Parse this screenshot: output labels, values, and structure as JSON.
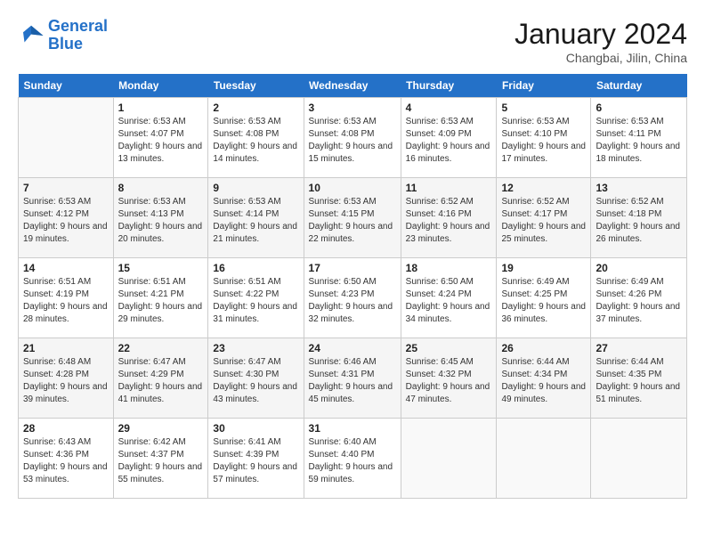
{
  "header": {
    "logo_line1": "General",
    "logo_line2": "Blue",
    "month_year": "January 2024",
    "location": "Changbai, Jilin, China"
  },
  "days_of_week": [
    "Sunday",
    "Monday",
    "Tuesday",
    "Wednesday",
    "Thursday",
    "Friday",
    "Saturday"
  ],
  "weeks": [
    [
      {
        "day": "",
        "sunrise": "",
        "sunset": "",
        "daylight": ""
      },
      {
        "day": "1",
        "sunrise": "Sunrise: 6:53 AM",
        "sunset": "Sunset: 4:07 PM",
        "daylight": "Daylight: 9 hours and 13 minutes."
      },
      {
        "day": "2",
        "sunrise": "Sunrise: 6:53 AM",
        "sunset": "Sunset: 4:08 PM",
        "daylight": "Daylight: 9 hours and 14 minutes."
      },
      {
        "day": "3",
        "sunrise": "Sunrise: 6:53 AM",
        "sunset": "Sunset: 4:08 PM",
        "daylight": "Daylight: 9 hours and 15 minutes."
      },
      {
        "day": "4",
        "sunrise": "Sunrise: 6:53 AM",
        "sunset": "Sunset: 4:09 PM",
        "daylight": "Daylight: 9 hours and 16 minutes."
      },
      {
        "day": "5",
        "sunrise": "Sunrise: 6:53 AM",
        "sunset": "Sunset: 4:10 PM",
        "daylight": "Daylight: 9 hours and 17 minutes."
      },
      {
        "day": "6",
        "sunrise": "Sunrise: 6:53 AM",
        "sunset": "Sunset: 4:11 PM",
        "daylight": "Daylight: 9 hours and 18 minutes."
      }
    ],
    [
      {
        "day": "7",
        "sunrise": "Sunrise: 6:53 AM",
        "sunset": "Sunset: 4:12 PM",
        "daylight": "Daylight: 9 hours and 19 minutes."
      },
      {
        "day": "8",
        "sunrise": "Sunrise: 6:53 AM",
        "sunset": "Sunset: 4:13 PM",
        "daylight": "Daylight: 9 hours and 20 minutes."
      },
      {
        "day": "9",
        "sunrise": "Sunrise: 6:53 AM",
        "sunset": "Sunset: 4:14 PM",
        "daylight": "Daylight: 9 hours and 21 minutes."
      },
      {
        "day": "10",
        "sunrise": "Sunrise: 6:53 AM",
        "sunset": "Sunset: 4:15 PM",
        "daylight": "Daylight: 9 hours and 22 minutes."
      },
      {
        "day": "11",
        "sunrise": "Sunrise: 6:52 AM",
        "sunset": "Sunset: 4:16 PM",
        "daylight": "Daylight: 9 hours and 23 minutes."
      },
      {
        "day": "12",
        "sunrise": "Sunrise: 6:52 AM",
        "sunset": "Sunset: 4:17 PM",
        "daylight": "Daylight: 9 hours and 25 minutes."
      },
      {
        "day": "13",
        "sunrise": "Sunrise: 6:52 AM",
        "sunset": "Sunset: 4:18 PM",
        "daylight": "Daylight: 9 hours and 26 minutes."
      }
    ],
    [
      {
        "day": "14",
        "sunrise": "Sunrise: 6:51 AM",
        "sunset": "Sunset: 4:19 PM",
        "daylight": "Daylight: 9 hours and 28 minutes."
      },
      {
        "day": "15",
        "sunrise": "Sunrise: 6:51 AM",
        "sunset": "Sunset: 4:21 PM",
        "daylight": "Daylight: 9 hours and 29 minutes."
      },
      {
        "day": "16",
        "sunrise": "Sunrise: 6:51 AM",
        "sunset": "Sunset: 4:22 PM",
        "daylight": "Daylight: 9 hours and 31 minutes."
      },
      {
        "day": "17",
        "sunrise": "Sunrise: 6:50 AM",
        "sunset": "Sunset: 4:23 PM",
        "daylight": "Daylight: 9 hours and 32 minutes."
      },
      {
        "day": "18",
        "sunrise": "Sunrise: 6:50 AM",
        "sunset": "Sunset: 4:24 PM",
        "daylight": "Daylight: 9 hours and 34 minutes."
      },
      {
        "day": "19",
        "sunrise": "Sunrise: 6:49 AM",
        "sunset": "Sunset: 4:25 PM",
        "daylight": "Daylight: 9 hours and 36 minutes."
      },
      {
        "day": "20",
        "sunrise": "Sunrise: 6:49 AM",
        "sunset": "Sunset: 4:26 PM",
        "daylight": "Daylight: 9 hours and 37 minutes."
      }
    ],
    [
      {
        "day": "21",
        "sunrise": "Sunrise: 6:48 AM",
        "sunset": "Sunset: 4:28 PM",
        "daylight": "Daylight: 9 hours and 39 minutes."
      },
      {
        "day": "22",
        "sunrise": "Sunrise: 6:47 AM",
        "sunset": "Sunset: 4:29 PM",
        "daylight": "Daylight: 9 hours and 41 minutes."
      },
      {
        "day": "23",
        "sunrise": "Sunrise: 6:47 AM",
        "sunset": "Sunset: 4:30 PM",
        "daylight": "Daylight: 9 hours and 43 minutes."
      },
      {
        "day": "24",
        "sunrise": "Sunrise: 6:46 AM",
        "sunset": "Sunset: 4:31 PM",
        "daylight": "Daylight: 9 hours and 45 minutes."
      },
      {
        "day": "25",
        "sunrise": "Sunrise: 6:45 AM",
        "sunset": "Sunset: 4:32 PM",
        "daylight": "Daylight: 9 hours and 47 minutes."
      },
      {
        "day": "26",
        "sunrise": "Sunrise: 6:44 AM",
        "sunset": "Sunset: 4:34 PM",
        "daylight": "Daylight: 9 hours and 49 minutes."
      },
      {
        "day": "27",
        "sunrise": "Sunrise: 6:44 AM",
        "sunset": "Sunset: 4:35 PM",
        "daylight": "Daylight: 9 hours and 51 minutes."
      }
    ],
    [
      {
        "day": "28",
        "sunrise": "Sunrise: 6:43 AM",
        "sunset": "Sunset: 4:36 PM",
        "daylight": "Daylight: 9 hours and 53 minutes."
      },
      {
        "day": "29",
        "sunrise": "Sunrise: 6:42 AM",
        "sunset": "Sunset: 4:37 PM",
        "daylight": "Daylight: 9 hours and 55 minutes."
      },
      {
        "day": "30",
        "sunrise": "Sunrise: 6:41 AM",
        "sunset": "Sunset: 4:39 PM",
        "daylight": "Daylight: 9 hours and 57 minutes."
      },
      {
        "day": "31",
        "sunrise": "Sunrise: 6:40 AM",
        "sunset": "Sunset: 4:40 PM",
        "daylight": "Daylight: 9 hours and 59 minutes."
      },
      {
        "day": "",
        "sunrise": "",
        "sunset": "",
        "daylight": ""
      },
      {
        "day": "",
        "sunrise": "",
        "sunset": "",
        "daylight": ""
      },
      {
        "day": "",
        "sunrise": "",
        "sunset": "",
        "daylight": ""
      }
    ]
  ]
}
